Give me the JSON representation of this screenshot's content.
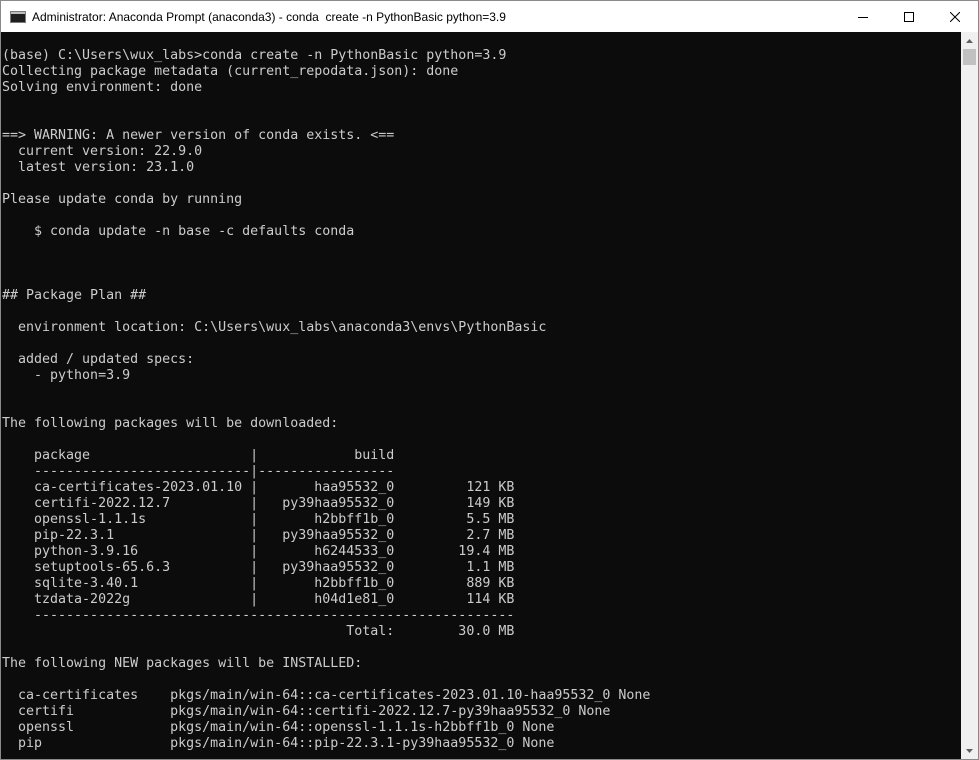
{
  "window": {
    "title": "Administrator: Anaconda Prompt (anaconda3) - conda  create -n PythonBasic python=3.9"
  },
  "controls": {
    "minimize_icon": "minimize-icon",
    "maximize_icon": "maximize-icon",
    "close_icon": "close-icon"
  },
  "colors": {
    "console_background": "#0c0c0c",
    "console_text": "#cccccc"
  },
  "console": {
    "lines": [
      "(base) C:\\Users\\wux_labs>conda create -n PythonBasic python=3.9",
      "Collecting package metadata (current_repodata.json): done",
      "Solving environment: done",
      "",
      "",
      "==> WARNING: A newer version of conda exists. <==",
      "  current version: 22.9.0",
      "  latest version: 23.1.0",
      "",
      "Please update conda by running",
      "",
      "    $ conda update -n base -c defaults conda",
      "",
      "",
      "",
      "## Package Plan ##",
      "",
      "  environment location: C:\\Users\\wux_labs\\anaconda3\\envs\\PythonBasic",
      "",
      "  added / updated specs:",
      "    - python=3.9",
      "",
      "",
      "The following packages will be downloaded:",
      "",
      "    package                    |            build",
      "    ---------------------------|-----------------",
      "    ca-certificates-2023.01.10 |       haa95532_0         121 KB",
      "    certifi-2022.12.7          |   py39haa95532_0         149 KB",
      "    openssl-1.1.1s             |       h2bbff1b_0         5.5 MB",
      "    pip-22.3.1                 |   py39haa95532_0         2.7 MB",
      "    python-3.9.16              |       h6244533_0        19.4 MB",
      "    setuptools-65.6.3          |   py39haa95532_0         1.1 MB",
      "    sqlite-3.40.1              |       h2bbff1b_0         889 KB",
      "    tzdata-2022g               |       h04d1e81_0         114 KB",
      "    ------------------------------------------------------------",
      "                                           Total:        30.0 MB",
      "",
      "The following NEW packages will be INSTALLED:",
      "",
      "  ca-certificates    pkgs/main/win-64::ca-certificates-2023.01.10-haa95532_0 None",
      "  certifi            pkgs/main/win-64::certifi-2022.12.7-py39haa95532_0 None",
      "  openssl            pkgs/main/win-64::openssl-1.1.1s-h2bbff1b_0 None",
      "  pip                pkgs/main/win-64::pip-22.3.1-py39haa95532_0 None"
    ]
  }
}
